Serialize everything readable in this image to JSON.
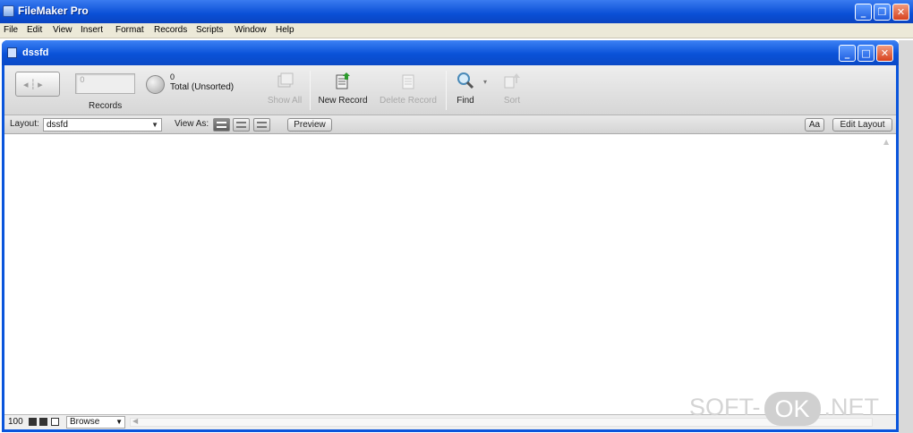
{
  "app": {
    "title": "FileMaker Pro"
  },
  "menu": [
    "File",
    "Edit",
    "View",
    "Insert",
    "Format",
    "Records",
    "Scripts",
    "Window",
    "Help"
  ],
  "document": {
    "title": "dssfd"
  },
  "toolbar": {
    "record_field_value": "0",
    "records_label": "Records",
    "total_count": "0",
    "total_label": "Total (Unsorted)",
    "buttons": {
      "show_all": "Show All",
      "new_record": "New Record",
      "delete_record": "Delete Record",
      "find": "Find",
      "sort": "Sort"
    }
  },
  "layoutbar": {
    "layout_label": "Layout:",
    "layout_value": "dssfd",
    "view_as_label": "View As:",
    "preview_label": "Preview",
    "font_button": "Aa",
    "edit_layout_label": "Edit Layout"
  },
  "statusbar": {
    "zoom": "100",
    "mode": "Browse"
  },
  "watermark": {
    "left": "SOFT-",
    "mid": "OK",
    "right": ".NET"
  }
}
